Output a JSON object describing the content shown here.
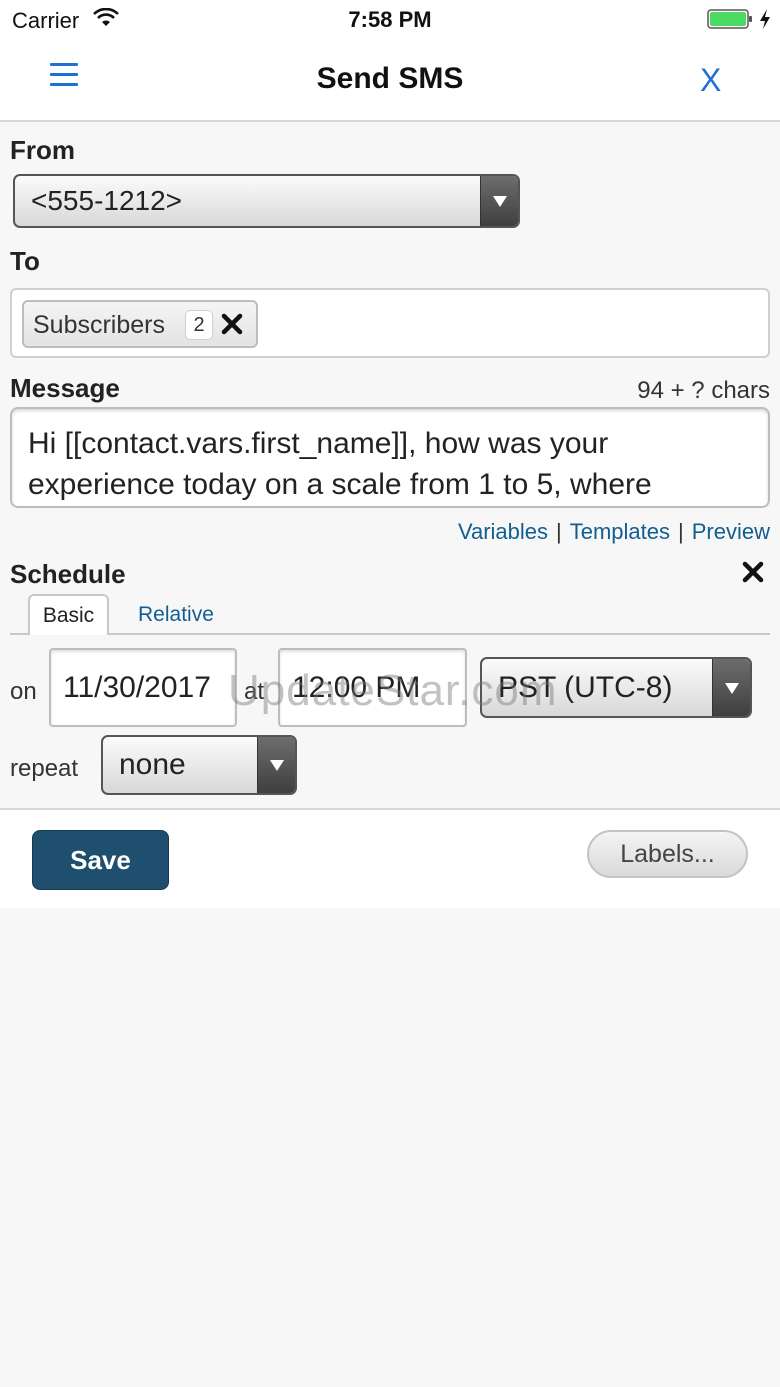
{
  "status_bar": {
    "carrier": "Carrier",
    "time": "7:58 PM",
    "battery_color": "#4cd964"
  },
  "navbar": {
    "title": "Send SMS",
    "close_label": "X",
    "menu_icon": "hamburger-menu-icon",
    "accent_color": "#1f6fd9"
  },
  "form": {
    "from": {
      "label": "From",
      "selected": "<555-1212>"
    },
    "to": {
      "label": "To",
      "token_label": "Subscribers",
      "token_count": "2"
    },
    "message": {
      "label": "Message",
      "char_count": "94 + ? chars",
      "text": "Hi [[contact.vars.first_name]], how was your experience today on a scale from 1 to 5, where",
      "links": [
        "Variables",
        "Templates",
        "Preview"
      ]
    },
    "schedule": {
      "label": "Schedule",
      "tabs": [
        "Basic",
        "Relative"
      ],
      "on_label": "on",
      "date": "11/30/2017",
      "at_label": "at",
      "time": "12:00 PM",
      "timezone": "PST (UTC-8)",
      "repeat_label": "repeat",
      "repeat": "none"
    }
  },
  "footer": {
    "save_label": "Save",
    "labels_label": "Labels...",
    "save_color": "#1e4f6f"
  },
  "watermark": "UpdateStar.com"
}
